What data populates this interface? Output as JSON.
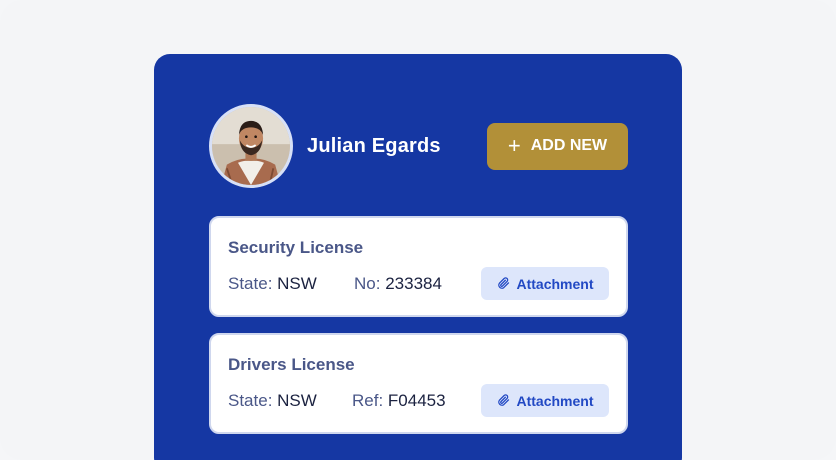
{
  "profile": {
    "name": "Julian Egards",
    "avatar_icon": "person-photo"
  },
  "actions": {
    "add_new_label": "ADD NEW",
    "add_icon": "plus-icon"
  },
  "licenses": [
    {
      "title": "Security License",
      "state_label": "State:",
      "state_value": "NSW",
      "id_label": "No:",
      "id_value": "233384",
      "attachment_label": "Attachment"
    },
    {
      "title": "Drivers License",
      "state_label": "State:",
      "state_value": "NSW",
      "id_label": "Ref:",
      "id_value": "F04453",
      "attachment_label": "Attachment"
    }
  ],
  "colors": {
    "page_bg": "#f4f5f7",
    "panel_bg": "#1537a3",
    "button_gold": "#b29038",
    "attachment_bg": "#dde6fb",
    "attachment_text": "#2249c4",
    "card_label": "#4a5788"
  }
}
